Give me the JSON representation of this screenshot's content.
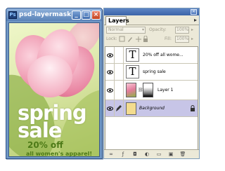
{
  "document": {
    "title": "psd-layermask...",
    "app_icon": "Ps",
    "buttons": {
      "minimize": "_",
      "maximize": "□",
      "close": "×"
    },
    "artwork": {
      "line1": "spring",
      "line2": "sale",
      "offer": "20% off",
      "subline": "all women's apparel!"
    }
  },
  "layers_panel": {
    "tab_label": "Layers",
    "menu_button": "▸",
    "blend_mode": "Normal",
    "opacity_label": "Opacity:",
    "opacity_value": "100%",
    "lock_label": "Lock:",
    "fill_label": "Fill:",
    "fill_value": "100%",
    "layers": [
      {
        "name": "20% off  all wome...",
        "kind": "text",
        "thumb": "T",
        "visible": true
      },
      {
        "name": "spring     sale",
        "kind": "text",
        "thumb": "T",
        "visible": true
      },
      {
        "name": "Layer 1",
        "kind": "image-with-mask",
        "visible": true
      },
      {
        "name": "Background",
        "kind": "background",
        "visible": true,
        "selected": true,
        "locked": true
      }
    ]
  },
  "colors": {
    "selection": "#c7c5e7",
    "title_bar": "#5b83b8",
    "artwork_green": "#4d7a17"
  }
}
